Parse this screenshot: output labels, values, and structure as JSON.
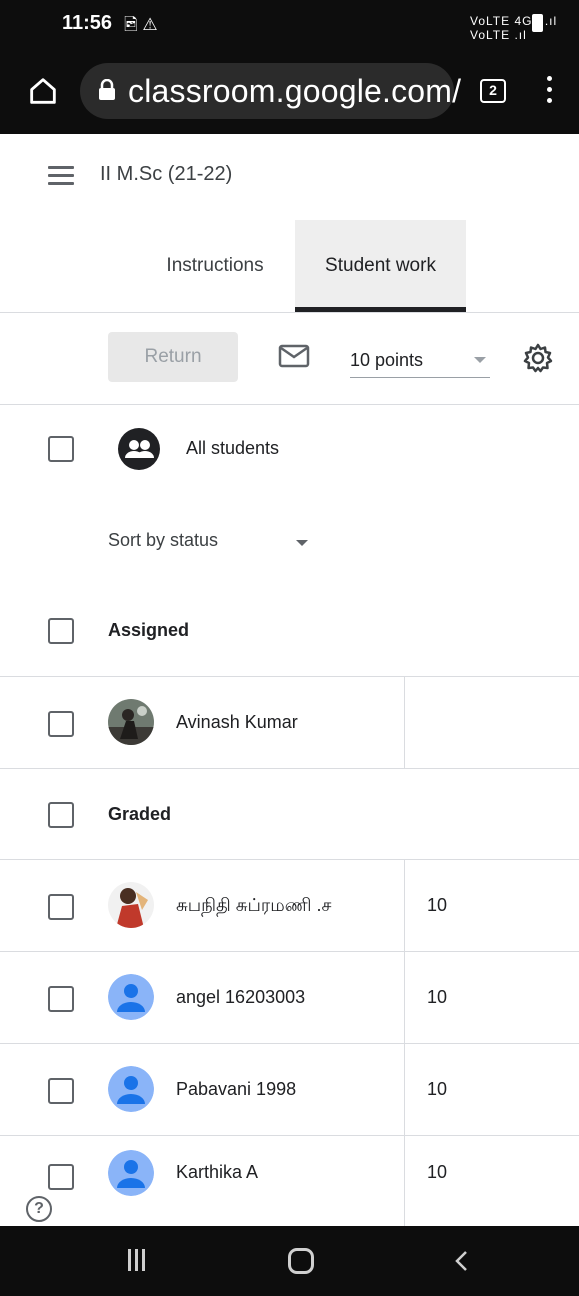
{
  "status_bar": {
    "time": "11:56",
    "notification_icons": "🖻 ⚠",
    "signal_text": "VoLTE 4G+ .ıl VoLTE .ıl"
  },
  "browser": {
    "url": "classroom.google.com/",
    "tab_count": "2"
  },
  "header": {
    "class_title": "II M.Sc (21-22)",
    "tabs": [
      {
        "label": "Instructions",
        "selected": false
      },
      {
        "label": "Student work",
        "selected": true
      }
    ]
  },
  "toolbar": {
    "return_label": "Return",
    "points_value": "10 points"
  },
  "all_students_label": "All students",
  "sort_label": "Sort by status",
  "groups": {
    "assigned": {
      "label": "Assigned",
      "students": [
        {
          "name": "Avinash Kumar",
          "grade": ""
        }
      ]
    },
    "graded": {
      "label": "Graded",
      "students": [
        {
          "name": "சுபநிதி சுப்ரமணி .ச",
          "grade": "10"
        },
        {
          "name": "angel 16203003",
          "grade": "10"
        },
        {
          "name": "Pabavani 1998",
          "grade": "10"
        },
        {
          "name": "Karthika A",
          "grade": "10"
        }
      ]
    }
  },
  "help_symbol": "?",
  "colors": {
    "default_avatar": "#8ab4f8",
    "default_avatar_fg": "#1a73e8",
    "system_bar": "#0d0d0d"
  }
}
